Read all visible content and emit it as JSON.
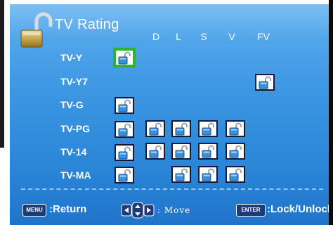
{
  "title": "TV Rating",
  "columns": [
    "D",
    "L",
    "S",
    "V",
    "FV"
  ],
  "rows": [
    {
      "label": "TV-Y",
      "cells": [
        "base"
      ]
    },
    {
      "label": "TV-Y7",
      "cells": [
        "fv"
      ]
    },
    {
      "label": "TV-G",
      "cells": [
        "base"
      ]
    },
    {
      "label": "TV-PG",
      "cells": [
        "base",
        "D",
        "L",
        "S",
        "V"
      ]
    },
    {
      "label": "TV-14",
      "cells": [
        "base",
        "D",
        "L",
        "S",
        "V"
      ]
    },
    {
      "label": "TV-MA",
      "cells": [
        "base",
        "L",
        "S",
        "V"
      ]
    }
  ],
  "selected": "TV-Y",
  "footer": {
    "menu_key": "MENU",
    "return_text": ":Return",
    "move_text": ": Move",
    "enter_key": "ENTER",
    "lock_text": ":Lock/Unlock"
  },
  "colors": {
    "background": "#3c96e2",
    "selection": "#2cb52c",
    "lock_body": "#3a8fd9",
    "cell_border": "#0f1c3a"
  },
  "icons": [
    "padlock-open-icon",
    "arrow-keys-icon"
  ]
}
